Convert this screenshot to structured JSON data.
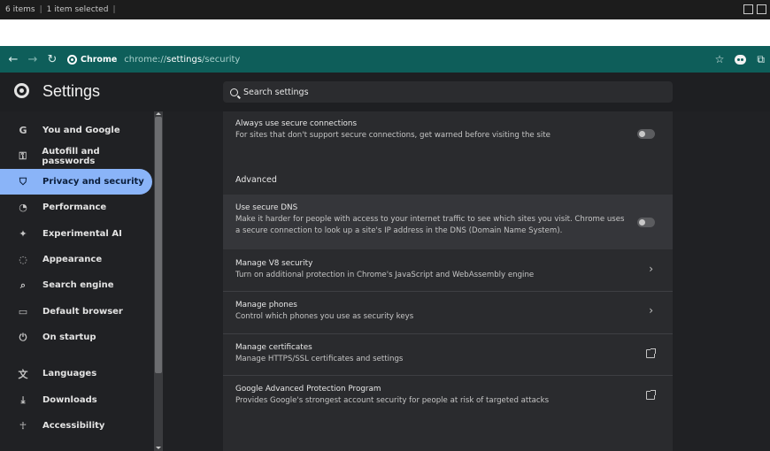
{
  "explorer_status": {
    "item_count": "6 items",
    "selection": "1 item selected"
  },
  "toolbar": {
    "chip_label": "Chrome",
    "url_scheme": "chrome://",
    "url_host": "settings",
    "url_path": "/security"
  },
  "header": {
    "title": "Settings",
    "search_placeholder": "Search settings"
  },
  "sidebar": {
    "items": [
      {
        "label": "You and Google",
        "icon": "google-g-icon"
      },
      {
        "label": "Autofill and passwords",
        "icon": "key-icon"
      },
      {
        "label": "Privacy and security",
        "icon": "shield-icon",
        "active": true
      },
      {
        "label": "Performance",
        "icon": "gauge-icon"
      },
      {
        "label": "Experimental AI",
        "icon": "sparkle-icon"
      },
      {
        "label": "Appearance",
        "icon": "palette-icon"
      },
      {
        "label": "Search engine",
        "icon": "search-icon"
      },
      {
        "label": "Default browser",
        "icon": "browser-window-icon"
      },
      {
        "label": "On startup",
        "icon": "power-icon"
      },
      {
        "label": "Languages",
        "icon": "translate-icon"
      },
      {
        "label": "Downloads",
        "icon": "download-icon"
      },
      {
        "label": "Accessibility",
        "icon": "accessibility-icon"
      }
    ]
  },
  "main": {
    "secure_connections": {
      "title": "Always use secure connections",
      "desc": "For sites that don't support secure connections, get warned before visiting the site",
      "enabled": false
    },
    "advanced_heading": "Advanced",
    "secure_dns": {
      "title": "Use secure DNS",
      "desc": "Make it harder for people with access to your internet traffic to see which sites you visit. Chrome uses a secure connection to look up a site's IP address in the DNS (Domain Name System).",
      "enabled": false
    },
    "v8_security": {
      "title": "Manage V8 security",
      "desc": "Turn on additional protection in Chrome's JavaScript and WebAssembly engine"
    },
    "phones": {
      "title": "Manage phones",
      "desc": "Control which phones you use as security keys"
    },
    "certificates": {
      "title": "Manage certificates",
      "desc": "Manage HTTPS/SSL certificates and settings"
    },
    "advanced_protection": {
      "title": "Google Advanced Protection Program",
      "desc": "Provides Google's strongest account security for people at risk of targeted attacks"
    }
  },
  "colors": {
    "toolbar_bg": "#0e5e5a",
    "page_bg": "#202124",
    "card_bg": "#2a2b2e",
    "active_nav": "#8ab4f8"
  }
}
